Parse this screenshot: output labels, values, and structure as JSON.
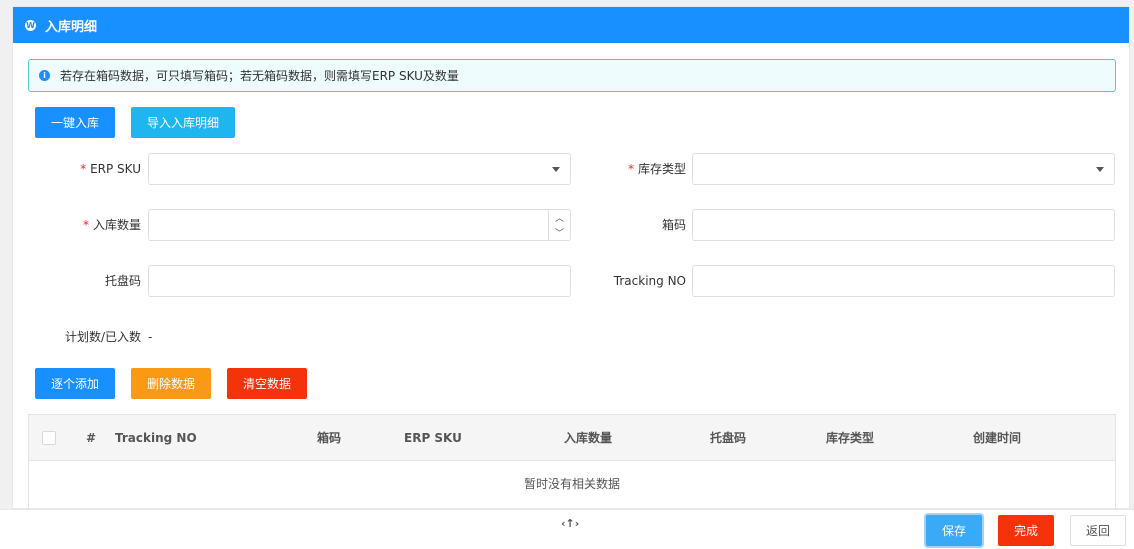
{
  "panel": {
    "title": "入库明细"
  },
  "alert": {
    "text": "若存在箱码数据，可只填写箱码；若无箱码数据，则需填写ERP SKU及数量"
  },
  "actions": {
    "one_click": "一键入库",
    "import": "导入入库明细"
  },
  "form": {
    "erp_sku": {
      "required": "*",
      "label": "ERP SKU",
      "value": ""
    },
    "stock_type": {
      "required": "*",
      "label": "库存类型",
      "value": ""
    },
    "quantity": {
      "required": "*",
      "label": "入库数量",
      "value": ""
    },
    "box_code": {
      "label": "箱码",
      "value": ""
    },
    "pallet_code": {
      "label": "托盘码",
      "value": ""
    },
    "tracking_no": {
      "label": "Tracking NO",
      "value": ""
    },
    "plan_label": "计划数/已入数",
    "plan_value": "-"
  },
  "row_actions": {
    "add": "逐个添加",
    "delete": "删除数据",
    "clear": "清空数据"
  },
  "table": {
    "columns": [
      "#",
      "Tracking NO",
      "箱码",
      "ERP SKU",
      "入库数量",
      "托盘码",
      "库存类型",
      "创建时间"
    ],
    "empty_text": "暂时没有相关数据"
  },
  "footer": {
    "save": "保存",
    "done": "完成",
    "back": "返回"
  },
  "icons": {
    "header": "wordpress-icon",
    "alert": "info-icon",
    "collapse": "collapse-arrows-icon"
  },
  "colors": {
    "primary": "#1890ff",
    "cyan": "#1fb6f0",
    "orange": "#fa9a14",
    "red": "#f5330b"
  }
}
